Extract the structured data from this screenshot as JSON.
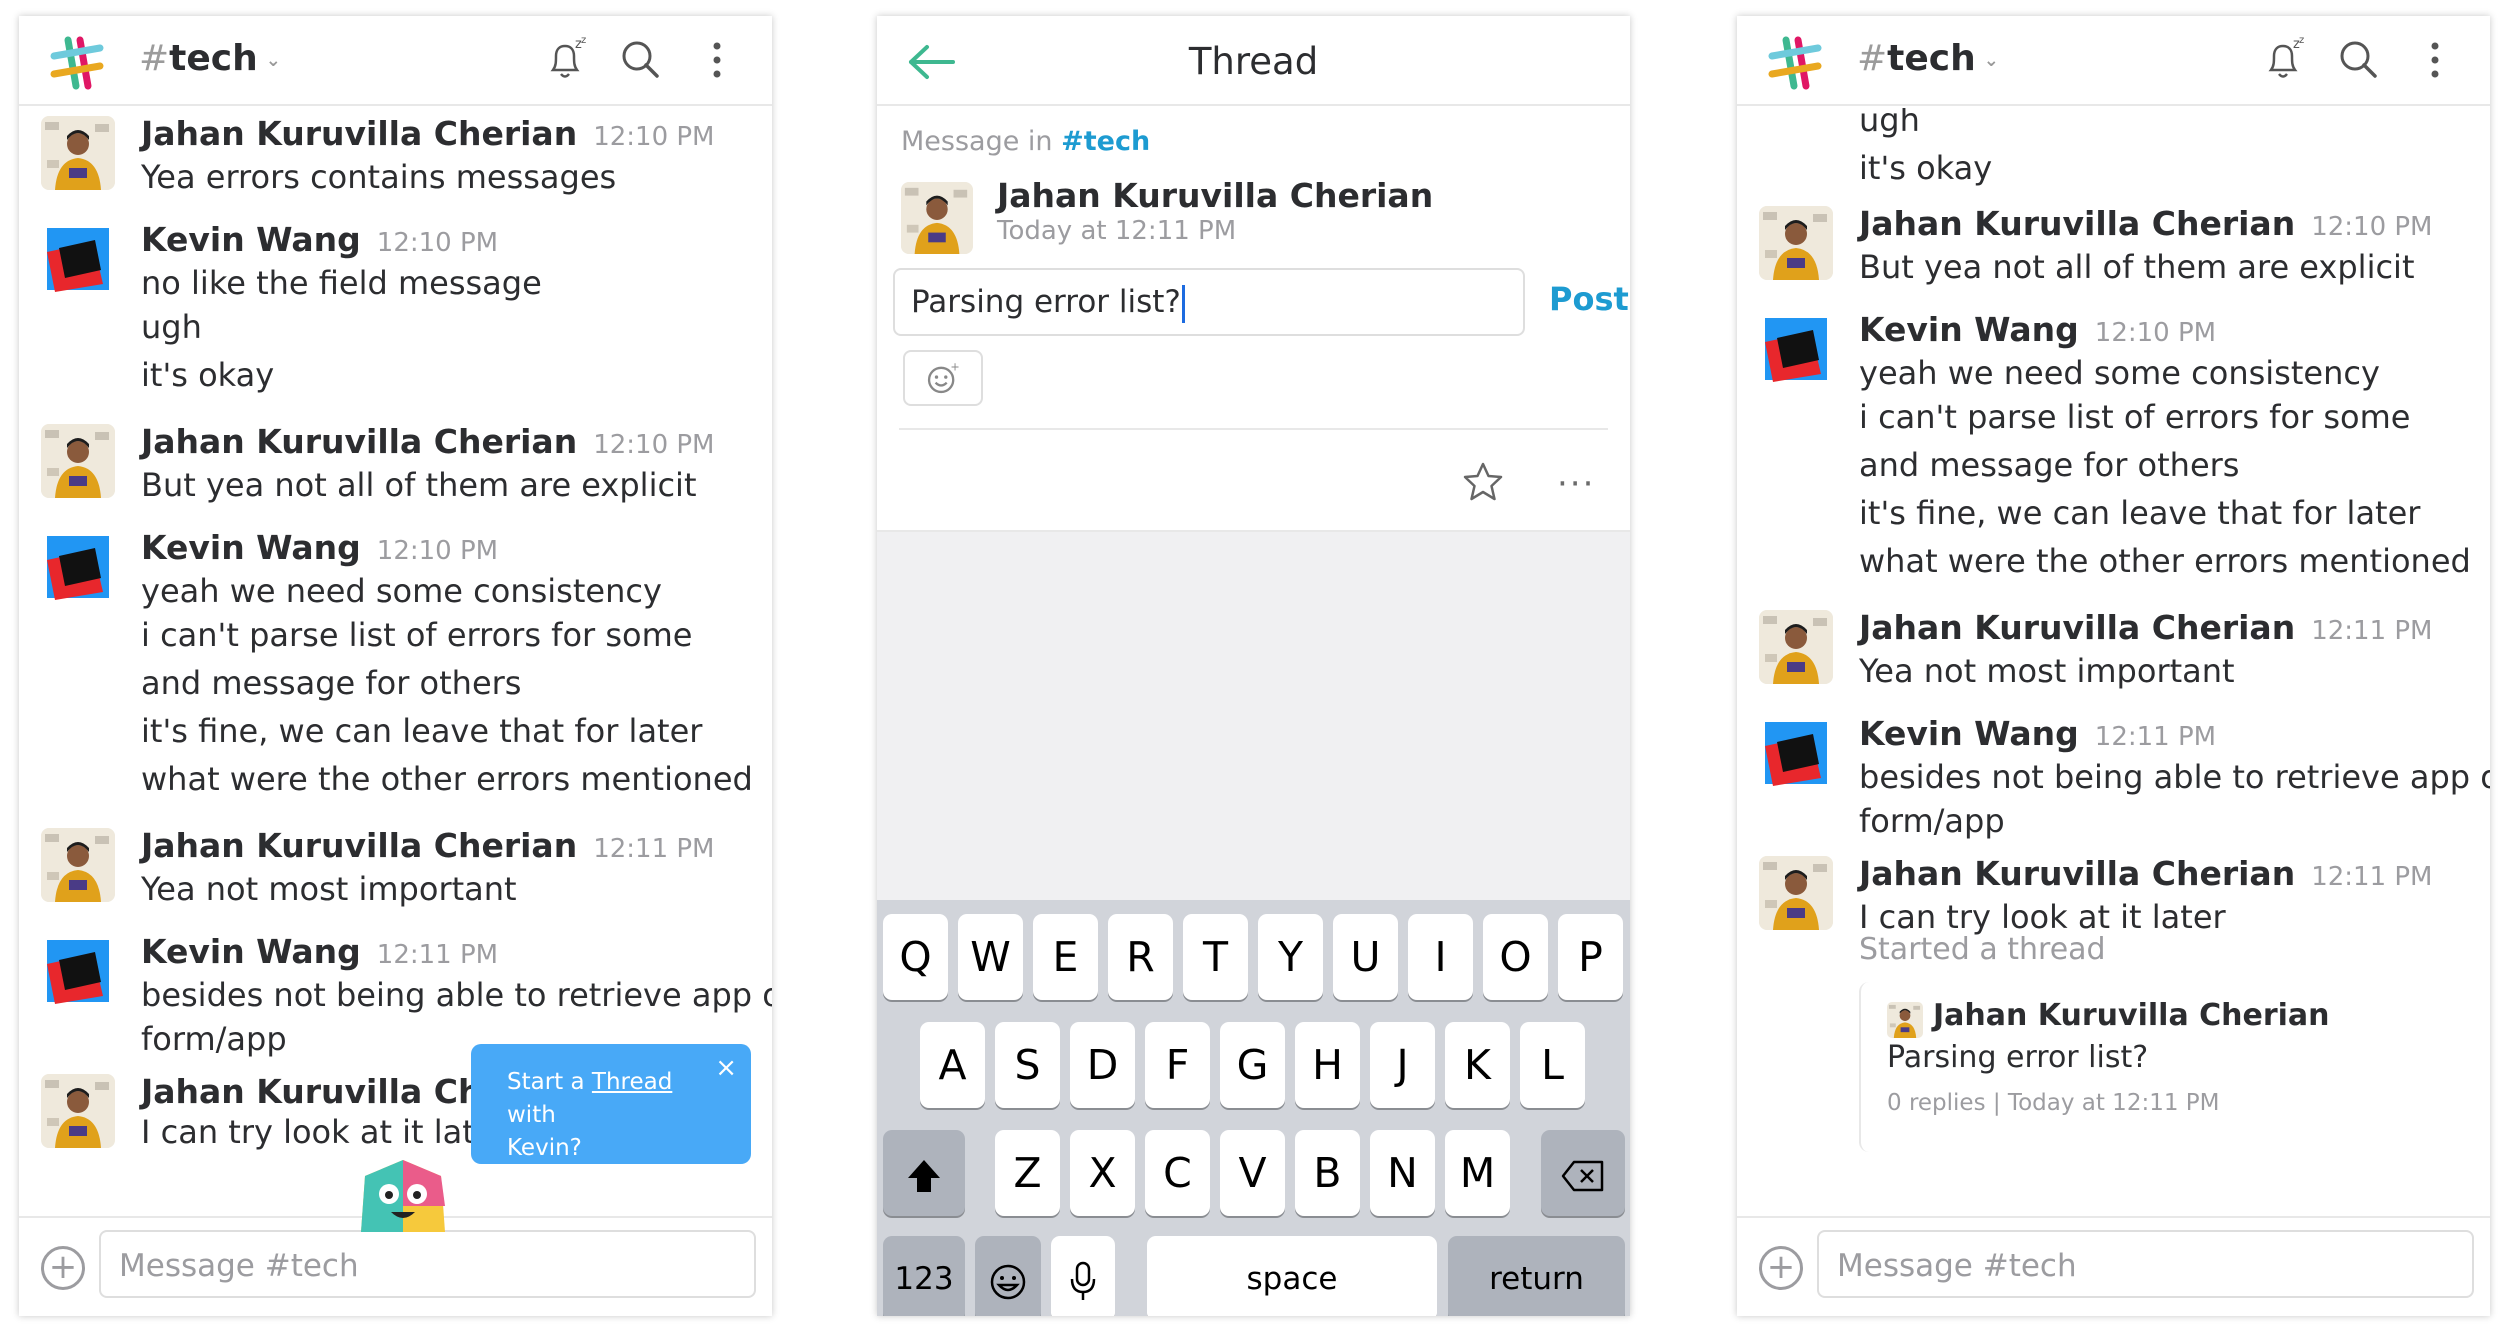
{
  "left_panel": {
    "channel_hash": "#",
    "channel_name": "tech",
    "messages": [
      {
        "author": "Jahan Kuruvilla Cherian",
        "time": "12:10 PM",
        "avatar": "jahan",
        "lines": [
          "Yea errors contains messages"
        ]
      },
      {
        "author": "Kevin Wang",
        "time": "12:10 PM",
        "avatar": "kevin",
        "lines": [
          "no like the field message",
          "ugh",
          "it's okay"
        ]
      },
      {
        "author": "Jahan Kuruvilla Cherian",
        "time": "12:10 PM",
        "avatar": "jahan",
        "lines": [
          "But yea not all of them are explicit"
        ]
      },
      {
        "author": "Kevin Wang",
        "time": "12:10 PM",
        "avatar": "kevin",
        "lines": [
          "yeah we need some consistency",
          "i can't parse list of errors for some",
          "and message for others",
          "it's fine, we can leave that for later",
          "what were the other errors mentioned"
        ]
      },
      {
        "author": "Jahan Kuruvilla Cherian",
        "time": "12:11 PM",
        "avatar": "jahan",
        "lines": [
          "Yea not most important"
        ]
      },
      {
        "author": "Kevin Wang",
        "time": "12:11 PM",
        "avatar": "kevin",
        "lines": [
          "besides not being able to retrieve app on /",
          "form/app"
        ]
      },
      {
        "author": "Jahan Kuruvilla Cherian",
        "time": "",
        "avatar": "jahan",
        "lines": [
          "I can try look at it later"
        ]
      }
    ],
    "tooltip": {
      "prefix": "Start a ",
      "link": "Thread",
      "suffix": " with",
      "line2": "Kevin?",
      "close": "×"
    },
    "composer_placeholder": "Message #tech"
  },
  "thread_panel": {
    "title": "Thread",
    "message_in_prefix": "Message in ",
    "message_in_channel": "#tech",
    "author": "Jahan Kuruvilla Cherian",
    "date": "Today at 12:11 PM",
    "reply_text": "Parsing error list?",
    "post_label": "Post",
    "more": "···",
    "keyboard": {
      "row1": [
        "Q",
        "W",
        "E",
        "R",
        "T",
        "Y",
        "U",
        "I",
        "O",
        "P"
      ],
      "row2": [
        "A",
        "S",
        "D",
        "F",
        "G",
        "H",
        "J",
        "K",
        "L"
      ],
      "row3": [
        "Z",
        "X",
        "C",
        "V",
        "B",
        "N",
        "M"
      ],
      "numbers": "123",
      "space": "space",
      "return": "return"
    }
  },
  "right_panel": {
    "channel_hash": "#",
    "channel_name": "tech",
    "top_lines": [
      "ugh",
      "it's okay"
    ],
    "messages": [
      {
        "author": "Jahan Kuruvilla Cherian",
        "time": "12:10 PM",
        "avatar": "jahan",
        "lines": [
          "But yea not all of them are explicit"
        ]
      },
      {
        "author": "Kevin Wang",
        "time": "12:10 PM",
        "avatar": "kevin",
        "lines": [
          "yeah we need some consistency",
          "i can't parse list of errors for some",
          "and message for others",
          "it's fine, we can leave that for later",
          "what were the other errors mentioned"
        ]
      },
      {
        "author": "Jahan Kuruvilla Cherian",
        "time": "12:11 PM",
        "avatar": "jahan",
        "lines": [
          "Yea not most important"
        ]
      },
      {
        "author": "Kevin Wang",
        "time": "12:11 PM",
        "avatar": "kevin",
        "lines": [
          "besides not being able to retrieve app on /",
          "form/app"
        ]
      },
      {
        "author": "Jahan Kuruvilla Cherian",
        "time": "12:11 PM",
        "avatar": "jahan",
        "lines": [
          "I can try look at it later"
        ]
      }
    ],
    "started_thread": "Started a thread",
    "thread_card": {
      "author": "Jahan Kuruvilla Cherian",
      "text": "Parsing error list?",
      "meta": "0 replies | Today at 12:11 PM"
    },
    "composer_placeholder": "Message #tech"
  }
}
